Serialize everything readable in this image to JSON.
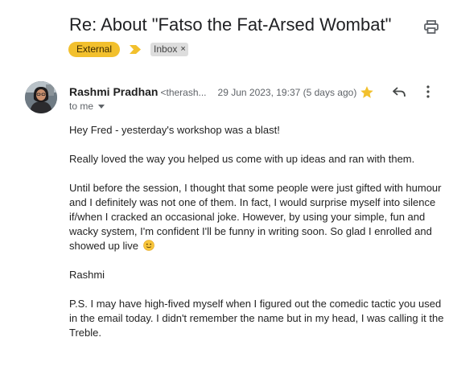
{
  "email": {
    "subject": "Re: About \"Fatso the Fat-Arsed Wombat\"",
    "labels": {
      "external": "External",
      "inbox": "Inbox",
      "inbox_remove": "×"
    },
    "sender": {
      "name": "Rashmi Pradhan",
      "email_truncated": "<therash...",
      "date": "29 Jun 2023, 19:37 (5 days ago)",
      "to": "to me"
    },
    "body": {
      "p1": "Hey Fred - yesterday's workshop was a blast!",
      "p2": "Really loved the way you helped us come with up ideas and ran with them.",
      "p3": "Until before the session, I thought that some people were just gifted with humour and I definitely was not one of them. In fact, I would surprise myself into silence if/when I cracked an occasional joke. However, by using your simple, fun and wacky system, I'm confident I'll be funny in writing soon. So glad I enrolled and showed up live",
      "p4": "Rashmi",
      "p5": "P.S. I may have high-fived myself when I figured out the comedic tactic you used in the email today. I didn't remember the name but in my head, I was calling it the Treble."
    }
  },
  "icons": {
    "print": "printer-icon",
    "importance": "importance-marker-icon",
    "star": "star-icon",
    "reply": "reply-icon",
    "more": "more-vert-icon",
    "caret": "caret-down-icon",
    "emoji": "slightly-smiling-face-emoji"
  },
  "colors": {
    "external_label": "#f2c02d",
    "importance_marker": "#f2c02d",
    "star": "#f2c02d",
    "inbox_label": "#dddddd"
  }
}
